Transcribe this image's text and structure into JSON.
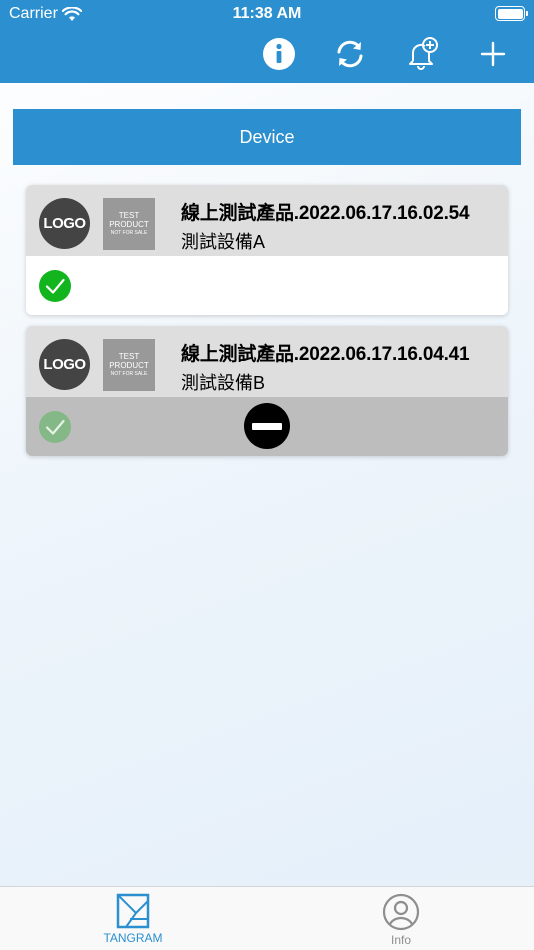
{
  "status_bar": {
    "carrier": "Carrier",
    "time": "11:38 AM"
  },
  "nav": {
    "icons": [
      "info-icon",
      "refresh-icon",
      "bell-plus-icon",
      "plus-icon"
    ]
  },
  "section": {
    "title": "Device"
  },
  "devices": [
    {
      "logo_text": "LOGO",
      "product_image": {
        "line1": "TEST",
        "line2": "PRODUCT",
        "line3": "NOT FOR SALE"
      },
      "name": "線上測試產品.2022.06.17.16.02.54",
      "subtitle": "測試設備A",
      "status": "connected",
      "disabled": false
    },
    {
      "logo_text": "LOGO",
      "product_image": {
        "line1": "TEST",
        "line2": "PRODUCT",
        "line3": "NOT FOR SALE"
      },
      "name": "線上測試產品.2022.06.17.16.04.41",
      "subtitle": "測試設備B",
      "status": "blocked",
      "disabled": true
    }
  ],
  "tabbar": {
    "tabs": [
      {
        "label": "TANGRAM",
        "active": true
      },
      {
        "label": "Info",
        "active": false
      }
    ]
  },
  "colors": {
    "primary": "#2b8fd0",
    "check_green": "#12b51e",
    "disabled_gray": "#bdbdbd"
  }
}
